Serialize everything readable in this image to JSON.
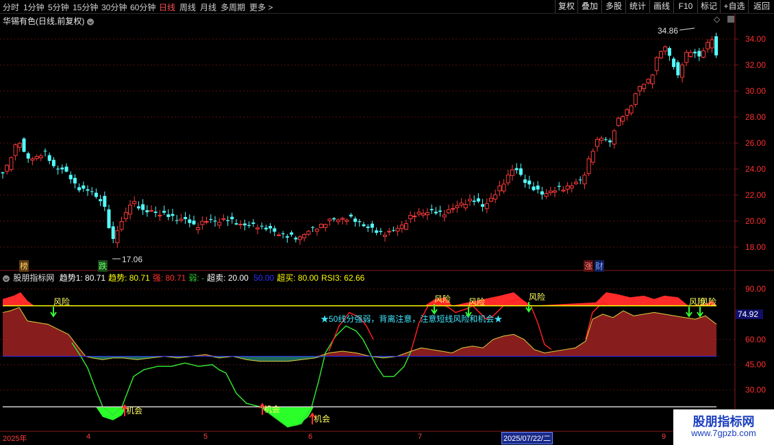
{
  "toolbar": {
    "periods": [
      "分时",
      "1分钟",
      "5分钟",
      "15分钟",
      "30分钟",
      "60分钟",
      "日线",
      "周线",
      "月线",
      "多周期",
      "更多 >"
    ],
    "active_period": "日线",
    "right_buttons": [
      "复权",
      "叠加",
      "多股",
      "统计",
      "画线",
      "F10",
      "标记",
      "+自选",
      "返回"
    ]
  },
  "stock": {
    "title": "华锡有色(日线,前复权)"
  },
  "price_axis": {
    "ticks": [
      "34.00",
      "32.00",
      "30.00",
      "28.00",
      "26.00",
      "24.00",
      "22.00",
      "20.00",
      "18.00"
    ]
  },
  "annotations": {
    "high": "34.86",
    "low": "17.06"
  },
  "badges": {
    "bang": "榜",
    "die": "跌",
    "zhang": "涨",
    "cai": "财"
  },
  "indicator": {
    "name": "股朋指标网",
    "items": [
      {
        "label": "趋势1:",
        "value": "80.71",
        "color": "#ffffff"
      },
      {
        "label": "趋势:",
        "value": "80.71",
        "color": "#ffff00"
      },
      {
        "label": "强:",
        "value": "80.71",
        "color": "#ff3030"
      },
      {
        "label": "弱:",
        "value": "-",
        "color": "#30d030"
      },
      {
        "label": "超卖:",
        "value": "20.00",
        "color": "#ffffff"
      },
      {
        "label": "",
        "value": "50.00",
        "color": "#3030ff"
      },
      {
        "label": "超买:",
        "value": "80.00",
        "color": "#ffff00"
      },
      {
        "label": "RSI3:",
        "value": "62.66",
        "color": "#ffff00"
      }
    ],
    "axis_ticks": [
      "90.00",
      "60.00",
      "45.00",
      "30.00"
    ],
    "current_value": "74.92",
    "risk_label": "风险",
    "opportunity_label": "机会",
    "note": "★50线分强弱，背离注意，注意短线风险和机会★"
  },
  "x_axis": {
    "labels": [
      "2025年",
      "4",
      "5",
      "6",
      "7",
      "9"
    ],
    "selected_date": "2025/07/22/二"
  },
  "watermark": {
    "line1": "股朋指标网",
    "line2": "www.7gpzb.com"
  }
}
